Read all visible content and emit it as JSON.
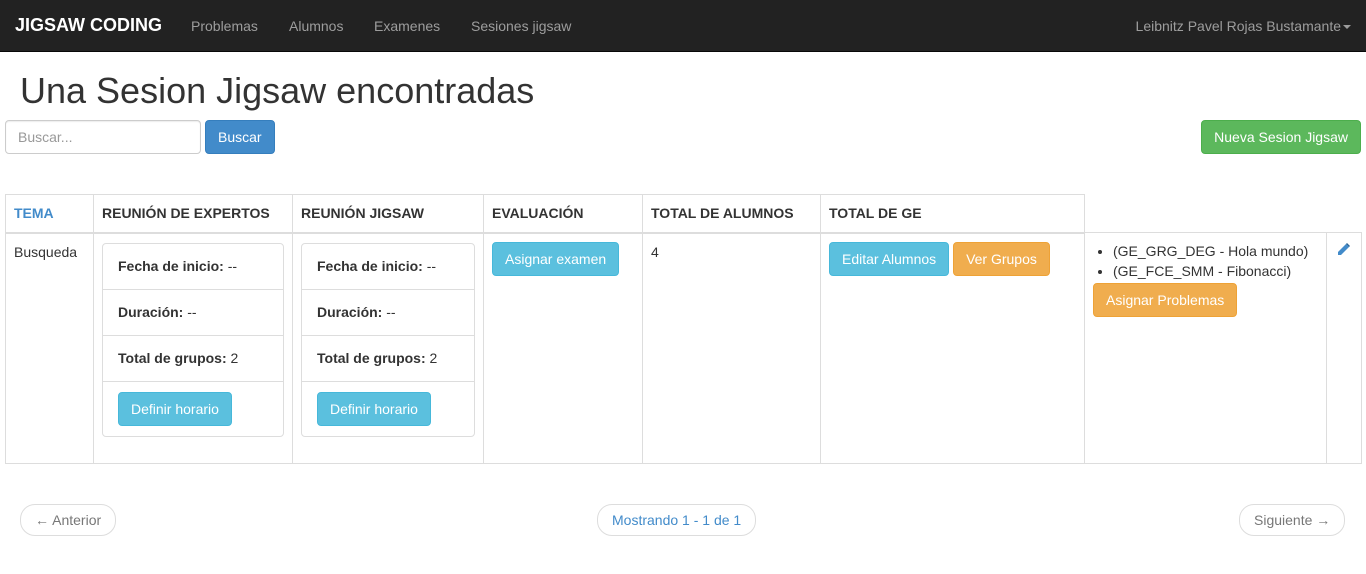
{
  "navbar": {
    "brand": "JIGSAW CODING",
    "links": [
      "Problemas",
      "Alumnos",
      "Examenes",
      "Sesiones jigsaw"
    ],
    "user": "Leibnitz Pavel Rojas Bustamante",
    "bg_color": "#222222"
  },
  "page": {
    "title": "Una Sesion Jigsaw encontradas"
  },
  "search": {
    "placeholder": "Buscar...",
    "value": "",
    "button": "Buscar"
  },
  "new_button": "Nueva Sesion Jigsaw",
  "table": {
    "headers": [
      "TEMA",
      "REUNIÓN DE EXPERTOS",
      "REUNIÓN JIGSAW",
      "EVALUACIÓN",
      "TOTAL DE ALUMNOS",
      "TOTAL DE GE"
    ],
    "rows": [
      {
        "tema": "Busqueda",
        "expertos": {
          "fecha_label": "Fecha de inicio:",
          "fecha_value": "--",
          "duracion_label": "Duración:",
          "duracion_value": "--",
          "grupos_label": "Total de grupos:",
          "grupos_value": "2",
          "button": "Definir horario"
        },
        "jigsaw": {
          "fecha_label": "Fecha de inicio:",
          "fecha_value": "--",
          "duracion_label": "Duración:",
          "duracion_value": "--",
          "grupos_label": "Total de grupos:",
          "grupos_value": "2",
          "button": "Definir horario"
        },
        "evaluacion_button": "Asignar examen",
        "total_alumnos": "4",
        "editar_alumnos": "Editar Alumnos",
        "ver_grupos": "Ver Grupos",
        "ge": [
          "(GE_GRG_DEG - Hola mundo)",
          "(GE_FCE_SMM - Fibonacci)"
        ],
        "asignar_problemas": "Asignar Problemas",
        "edit_icon": "pencil-icon"
      }
    ]
  },
  "pagination": {
    "prev": "← Anterior",
    "status": "Mostrando 1 - 1 de 1",
    "next": "Siguiente →"
  },
  "colors": {
    "primary": "#428bca",
    "success": "#5cb85c",
    "info": "#5bc0de",
    "warning": "#f0ad4e"
  }
}
